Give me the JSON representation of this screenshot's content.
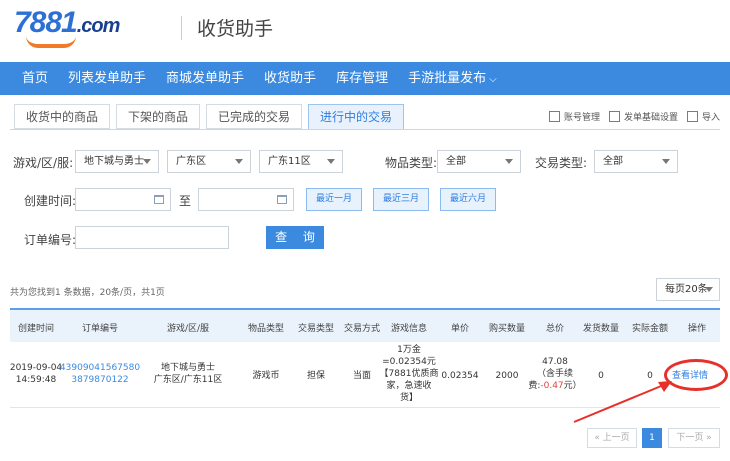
{
  "header": {
    "logo_main": "7881",
    "logo_suffix": ".com",
    "title": "收货助手"
  },
  "nav": [
    {
      "label": "首页"
    },
    {
      "label": "列表发单助手"
    },
    {
      "label": "商城发单助手"
    },
    {
      "label": "收货助手"
    },
    {
      "label": "库存管理"
    },
    {
      "label": "手游批量发布"
    }
  ],
  "tabs": [
    {
      "label": "收货中的商品"
    },
    {
      "label": "下架的商品"
    },
    {
      "label": "已完成的交易"
    },
    {
      "label": "进行中的交易"
    }
  ],
  "tab_links": {
    "account": "账号管理",
    "settings": "发单基础设置",
    "import": "导入"
  },
  "filters": {
    "game_label": "游戏/区/服:",
    "game": "地下城与勇士",
    "region": "广东区",
    "server": "广东11区",
    "item_type_label": "物品类型:",
    "item_type": "全部",
    "trade_type_label": "交易类型:",
    "trade_type": "全部",
    "created_label": "创建时间:",
    "to_label": "至",
    "quick": [
      "最近一月",
      "最近三月",
      "最近六月"
    ],
    "order_label": "订单编号:",
    "search": "查 询"
  },
  "summary": "共为您找到1 条数据，20条/页，共1页",
  "per_page": "每页20条",
  "table": {
    "headers": [
      "创建时间",
      "订单编号",
      "游戏/区/服",
      "物品类型",
      "交易类型",
      "交易方式",
      "游戏信息",
      "单价",
      "购买数量",
      "总价",
      "发货数量",
      "实际金额",
      "操作"
    ],
    "row": {
      "date": "2019-09-04",
      "time": "14:59:48",
      "order_1": "43909041567580",
      "order_2": "3879870122",
      "game_1": "地下城与勇士",
      "game_2": "广东区/广东11区",
      "item_type": "游戏币",
      "trade_type": "担保",
      "trade_method": "当面",
      "info_1": "1万金",
      "info_2": "=0.02354元",
      "info_3": "【7881优质商",
      "info_4": "家，急速收",
      "info_5": "货】",
      "unit_price": "0.02354",
      "quantity": "2000",
      "total_1": "47.08",
      "total_2": "（含手续",
      "total_3a": "费:",
      "total_3b": "-0.47",
      "total_3c": "元）",
      "shipped": "0",
      "actual": "0",
      "action": "查看详情"
    }
  },
  "pager": {
    "prev": "« 上一页",
    "page": "1",
    "next": "下一页 »"
  },
  "colors": {
    "primary": "#3b8ae0",
    "highlight": "#e8302a",
    "logo_orange": "#f07a28"
  }
}
